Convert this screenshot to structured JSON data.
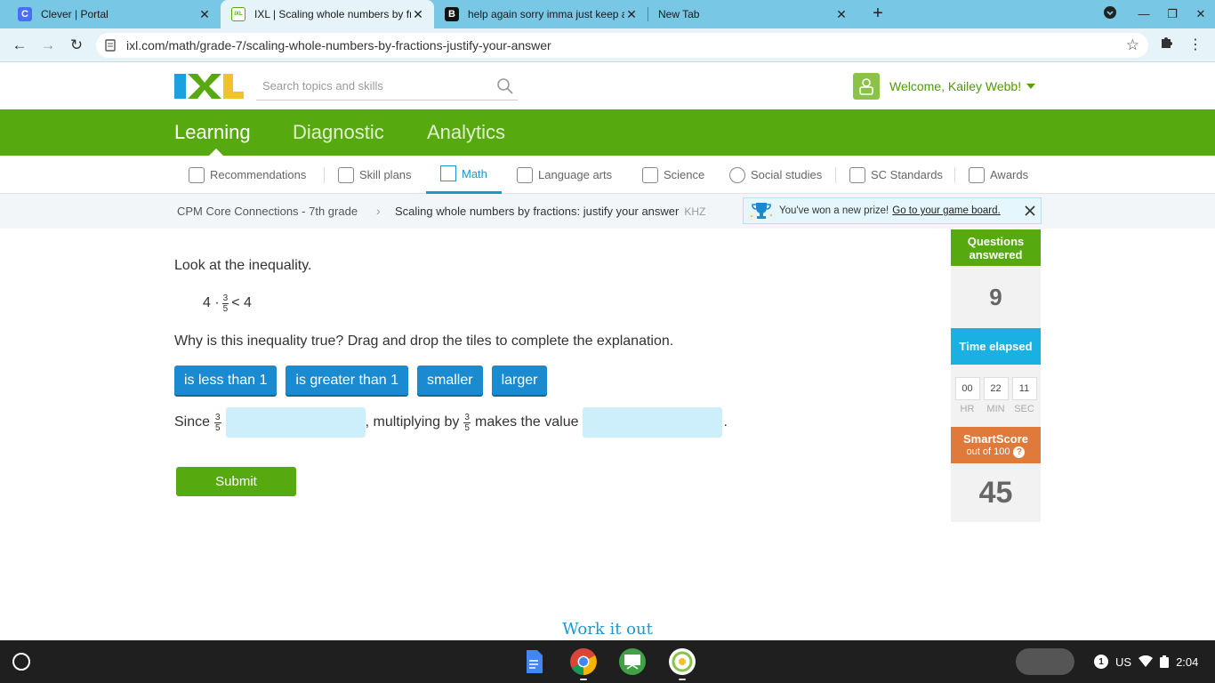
{
  "browser": {
    "tabs": [
      {
        "title": "Clever | Portal",
        "favicon": "C"
      },
      {
        "title": "IXL | Scaling whole numbers by fra",
        "favicon": "IXL"
      },
      {
        "title": "help again sorry imma just keep a",
        "favicon": "B"
      },
      {
        "title": "New Tab",
        "favicon": ""
      }
    ],
    "url": "ixl.com/math/grade-7/scaling-whole-numbers-by-fractions-justify-your-answer"
  },
  "header": {
    "search_placeholder": "Search topics and skills",
    "welcome": "Welcome, Kailey Webb!"
  },
  "main_nav": [
    "Learning",
    "Diagnostic",
    "Analytics"
  ],
  "sub_nav": [
    "Recommendations",
    "Skill plans",
    "Math",
    "Language arts",
    "Science",
    "Social studies",
    "SC Standards",
    "Awards"
  ],
  "breadcrumb": {
    "course": "CPM Core Connections - 7th grade",
    "skill": "Scaling whole numbers by fractions: justify your answer",
    "code": "KHZ"
  },
  "prize": {
    "text": "You've won a new prize!",
    "link": "Go to your game board."
  },
  "question": {
    "prompt1": "Look at the inequality.",
    "expr_left": "4 ·",
    "frac_num": "3",
    "frac_den": "5",
    "expr_right": "< 4",
    "prompt2": "Why is this inequality true? Drag and drop the tiles to complete the explanation.",
    "tiles": [
      "is less than 1",
      "is greater than 1",
      "smaller",
      "larger"
    ],
    "s_since": "Since",
    "s_mid": ", multiplying by",
    "s_makes": "makes the value",
    "s_end": ".",
    "submit": "Submit"
  },
  "stats": {
    "questions_label": "Questions answered",
    "questions_value": "9",
    "time_label": "Time elapsed",
    "time": {
      "hr": "00",
      "min": "22",
      "sec": "11",
      "hr_label": "HR",
      "min_label": "MIN",
      "sec_label": "SEC"
    },
    "smartscore_label": "SmartScore",
    "smartscore_sub": "out of 100",
    "smartscore_help": "?",
    "smartscore_value": "45"
  },
  "work_it_out": "Work it out",
  "shelf": {
    "notif_count": "1",
    "locale": "US",
    "time": "2:04"
  },
  "colors": {
    "ixl_green": "#56a90e",
    "tile_blue": "#1a8ad1",
    "drop_blue": "#cdeefb",
    "questions_green": "#56a90e",
    "time_blue": "#1bb0e3",
    "smartscore_orange": "#e07a3a"
  }
}
